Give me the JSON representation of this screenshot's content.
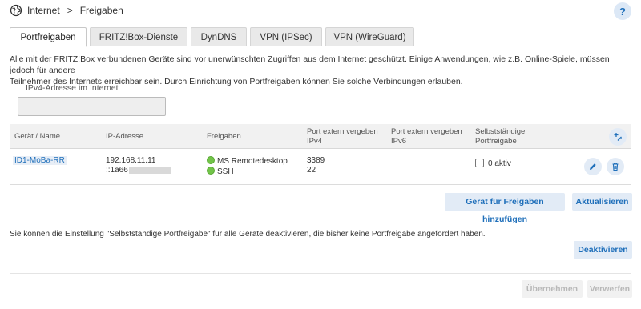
{
  "breadcrumb": {
    "parent": "Internet",
    "separator": ">",
    "current": "Freigaben"
  },
  "help_label": "?",
  "tabs": [
    {
      "label": "Portfreigaben",
      "active": true
    },
    {
      "label": "FRITZ!Box-Dienste",
      "active": false
    },
    {
      "label": "DynDNS",
      "active": false
    },
    {
      "label": "VPN (IPSec)",
      "active": false
    },
    {
      "label": "VPN (WireGuard)",
      "active": false
    }
  ],
  "intro": {
    "line1": "Alle mit der FRITZ!Box verbundenen Geräte sind vor unerwünschten Zugriffen aus dem Internet geschützt. Einige Anwendungen, wie z.B. Online-Spiele, müssen jedoch für andere",
    "line2": "Teilnehmer des Internets erreichbar sein. Durch Einrichtung von Portfreigaben können Sie solche Verbindungen erlauben."
  },
  "ipv4": {
    "label": "IPv4-Adresse im Internet",
    "value": ""
  },
  "table": {
    "headers": {
      "device": "Gerät / Name",
      "ip": "IP-Adresse",
      "shares": "Freigaben",
      "port_v4_line1": "Port extern vergeben",
      "port_v4_line2": "IPv4",
      "port_v6_line1": "Port extern vergeben",
      "port_v6_line2": "IPv6",
      "self_line1": "Selbstständige",
      "self_line2": "Portfreigabe"
    },
    "rows": [
      {
        "device": "ID1-MoBa-RR",
        "ipv4": "192.168.11.11",
        "ipv6_prefix": "::1a66",
        "share1": "MS Remotedesktop",
        "share2": "SSH",
        "port1": "3389",
        "port2": "22",
        "self_label": "0 aktiv"
      }
    ]
  },
  "buttons": {
    "add_device": "Gerät für Freigaben hinzufügen",
    "refresh": "Aktualisieren",
    "deactivate": "Deaktivieren",
    "apply": "Übernehmen",
    "discard": "Verwerfen"
  },
  "note": "Sie können die Einstellung \"Selbstständige Portfreigabe\" für alle Geräte deaktivieren, die bisher keine Portfreigabe angefordert haben.",
  "colors": {
    "accent": "#1f6fba",
    "button_bg": "#e2ebf6",
    "status_green": "#72c449"
  }
}
